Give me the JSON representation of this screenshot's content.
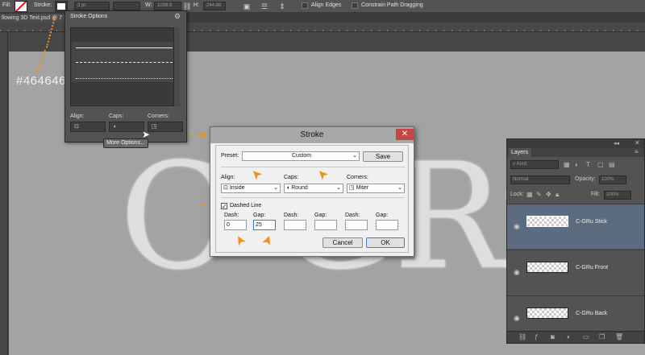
{
  "options_bar": {
    "fill_label": "Fill:",
    "stroke_label": "Stroke:",
    "stroke_width": "3 pt",
    "w_label": "W:",
    "w_value": "1039.9",
    "h_label": "H:",
    "h_value": "244.88",
    "align_edges": "Align Edges",
    "constrain_path": "Constrain Path Dragging"
  },
  "document": {
    "tab_title": "llowing 3D Text.psd @ 7"
  },
  "annotation": {
    "hex_color": "#464646"
  },
  "canvas_text": "C-GRu",
  "stroke_options": {
    "title": "Stroke Options",
    "align_label": "Align:",
    "caps_label": "Caps:",
    "corners_label": "Corners:",
    "more_options": "More Options..."
  },
  "stroke_dialog": {
    "title": "Stroke",
    "preset_label": "Preset:",
    "preset_value": "Custom",
    "save": "Save",
    "align_label": "Align:",
    "align_value": "Inside",
    "caps_label": "Caps:",
    "caps_value": "Round",
    "corners_label": "Corners:",
    "corners_value": "Miter",
    "dashed_line": "Dashed Line",
    "dash_gap": [
      {
        "dash_label": "Dash:",
        "dash_value": "0",
        "gap_label": "Gap:",
        "gap_value": "25"
      },
      {
        "dash_label": "Dash:",
        "dash_value": "",
        "gap_label": "Gap:",
        "gap_value": ""
      },
      {
        "dash_label": "Dash:",
        "dash_value": "",
        "gap_label": "Gap:",
        "gap_value": ""
      }
    ],
    "cancel": "Cancel",
    "ok": "OK"
  },
  "layers_panel": {
    "tab": "Layers",
    "filter_kind": "Kind",
    "blend_mode": "Normal",
    "opacity_label": "Opacity:",
    "opacity_value": "100%",
    "lock_label": "Lock:",
    "fill_label": "Fill:",
    "fill_value": "100%",
    "layers": [
      {
        "name": "C-GRu Stick",
        "selected": true
      },
      {
        "name": "C-GRu Front",
        "selected": false
      },
      {
        "name": "C-GRu Back",
        "selected": false
      }
    ]
  },
  "colors": {
    "annotation_orange": "#f0901c",
    "canvas_gray": "#a3a3a3",
    "background": "#464646",
    "selected_layer": "#5b6b80"
  }
}
